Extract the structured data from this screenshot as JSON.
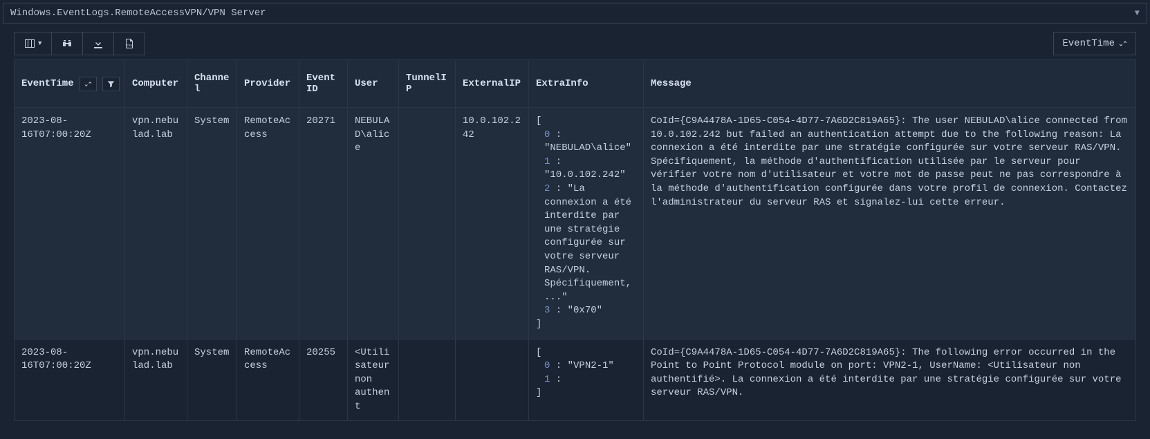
{
  "breadcrumb": "Windows.EventLogs.RemoteAccessVPN/VPN Server",
  "sortButton": {
    "label": "EventTime"
  },
  "columns": {
    "eventtime": "EventTime",
    "computer": "Computer",
    "channel": "Channel",
    "provider": "Provider",
    "eventid": "EventID",
    "user": "User",
    "tunnelip": "TunnelIP",
    "externalip": "ExternalIP",
    "extrainfo": "ExtraInfo",
    "message": "Message"
  },
  "rows": [
    {
      "eventtime": "2023-08-16T07:00:20Z",
      "computer": "vpn.nebulad.lab",
      "channel": "System",
      "provider": "RemoteAccess",
      "eventid": "20271",
      "user": "NEBULAD\\alice",
      "tunnelip": "",
      "externalip": "10.0.102.242",
      "extrainfo": {
        "items": [
          {
            "k": "0",
            "v": "\"NEBULAD\\alice\""
          },
          {
            "k": "1",
            "v": "\"10.0.102.242\""
          },
          {
            "k": "2",
            "v": "\"La connexion a été interdite par une stratégie configurée sur votre serveur RAS/VPN. Spécifiquement, ...\""
          },
          {
            "k": "3",
            "v": "\"0x70\""
          }
        ]
      },
      "message": "CoId={C9A4478A-1D65-C054-4D77-7A6D2C819A65}: The user NEBULAD\\alice connected from 10.0.102.242 but failed an authentication attempt due to the following reason: La connexion a été interdite par une stratégie configurée sur votre serveur RAS/VPN. Spécifiquement, la méthode d'authentification utilisée par le serveur pour vérifier votre nom d'utilisateur et votre mot de passe peut ne pas correspondre à la méthode d'authentification configurée dans votre profil de connexion. Contactez l'administrateur du serveur RAS et signalez-lui cette erreur."
    },
    {
      "eventtime": "2023-08-16T07:00:20Z",
      "computer": "vpn.nebulad.lab",
      "channel": "System",
      "provider": "RemoteAccess",
      "eventid": "20255",
      "user": "<Utilisateur non authent",
      "tunnelip": "",
      "externalip": "",
      "extrainfo": {
        "items": [
          {
            "k": "0",
            "v": "\"VPN2-1\""
          },
          {
            "k": "1",
            "v": ""
          }
        ]
      },
      "message": "CoId={C9A4478A-1D65-C054-4D77-7A6D2C819A65}: The following error occurred in the Point to Point Protocol module on port: VPN2-1, UserName: <Utilisateur non authentifié>. La connexion a été interdite par une stratégie configurée sur votre serveur RAS/VPN."
    }
  ]
}
